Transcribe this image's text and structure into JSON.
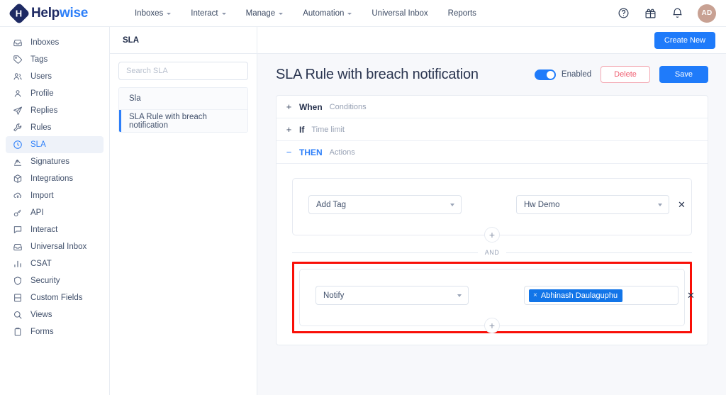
{
  "topnav": {
    "brand": {
      "part1": "Help",
      "part2": "wise",
      "mark_icon": "helpwise-logo-icon"
    },
    "links": [
      {
        "label": "Inboxes",
        "has_caret": true
      },
      {
        "label": "Interact",
        "has_caret": true
      },
      {
        "label": "Manage",
        "has_caret": true
      },
      {
        "label": "Automation",
        "has_caret": true
      },
      {
        "label": "Universal Inbox",
        "has_caret": false
      },
      {
        "label": "Reports",
        "has_caret": false
      }
    ],
    "right_icons": [
      "help-circle-icon",
      "gift-icon",
      "bell-icon"
    ],
    "avatar_initials": "AD"
  },
  "sidebar": {
    "items": [
      {
        "label": "Inboxes",
        "icon": "inbox-icon",
        "active": false
      },
      {
        "label": "Tags",
        "icon": "tag-icon",
        "active": false
      },
      {
        "label": "Users",
        "icon": "users-icon",
        "active": false
      },
      {
        "label": "Profile",
        "icon": "person-icon",
        "active": false
      },
      {
        "label": "Replies",
        "icon": "send-icon",
        "active": false
      },
      {
        "label": "Rules",
        "icon": "wrench-icon",
        "active": false
      },
      {
        "label": "SLA",
        "icon": "clock-icon",
        "active": true
      },
      {
        "label": "Signatures",
        "icon": "signature-icon",
        "active": false
      },
      {
        "label": "Integrations",
        "icon": "box-icon",
        "active": false
      },
      {
        "label": "Import",
        "icon": "cloud-download-icon",
        "active": false
      },
      {
        "label": "API",
        "icon": "key-icon",
        "active": false
      },
      {
        "label": "Interact",
        "icon": "chat-icon",
        "active": false
      },
      {
        "label": "Universal Inbox",
        "icon": "inbox-icon",
        "active": false
      },
      {
        "label": "CSAT",
        "icon": "bar-chart-icon",
        "active": false
      },
      {
        "label": "Security",
        "icon": "shield-icon",
        "active": false
      },
      {
        "label": "Custom Fields",
        "icon": "fields-icon",
        "active": false
      },
      {
        "label": "Views",
        "icon": "search-icon",
        "active": false
      },
      {
        "label": "Forms",
        "icon": "clipboard-icon",
        "active": false
      }
    ]
  },
  "sla_panel": {
    "heading": "SLA",
    "search_placeholder": "Search SLA",
    "search_value": "",
    "items": [
      {
        "label": "Sla",
        "selected": false
      },
      {
        "label": "SLA Rule with breach notification",
        "selected": true
      }
    ]
  },
  "main": {
    "create_new_label": "Create New",
    "rule_title": "SLA Rule with breach notification",
    "toggle_label": "Enabled",
    "toggle_on": true,
    "delete_label": "Delete",
    "save_label": "Save",
    "accordion": [
      {
        "sign": "+",
        "keyword": "When",
        "subtitle": "Conditions",
        "open": false
      },
      {
        "sign": "+",
        "keyword": "If",
        "subtitle": "Time limit",
        "open": false
      },
      {
        "sign": "−",
        "keyword": "THEN",
        "subtitle": "Actions",
        "open": true
      }
    ],
    "actions": [
      {
        "action_select": "Add Tag",
        "value_select": "Hw Demo",
        "value_type": "select",
        "remove_label": "✕",
        "add_label": "+",
        "highlighted": false
      },
      {
        "action_select": "Notify",
        "value_type": "chips",
        "chips": [
          {
            "label": "Abhinash Daulaguphu",
            "remove": "×"
          }
        ],
        "remove_label": "✕",
        "add_label": "+",
        "highlighted": true
      }
    ],
    "and_separator": "AND"
  },
  "colors": {
    "accent": "#1f7bfa",
    "danger": "#ef5b6e",
    "highlight": "#f90f07",
    "chip": "#1275e8",
    "brand_dark": "#1e2a63"
  }
}
